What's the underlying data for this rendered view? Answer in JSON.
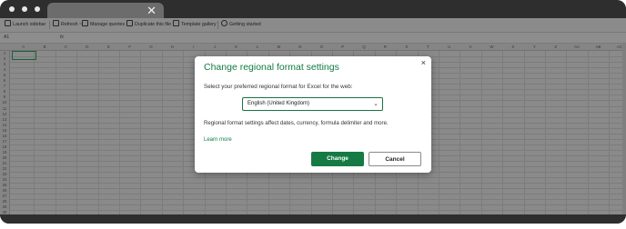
{
  "browser": {
    "tab_close": "✕"
  },
  "toolbar": {
    "items": [
      {
        "label": "Launch sidebar",
        "icon": "sidebar-icon"
      },
      {
        "label": "Refresh ~",
        "icon": "refresh-icon"
      },
      {
        "label": "Manage queries",
        "icon": "queries-icon"
      },
      {
        "label": "Duplicate this file",
        "icon": "duplicate-icon"
      },
      {
        "label": "Template gallery",
        "icon": "template-icon"
      },
      {
        "label": "Getting started",
        "icon": "help-icon"
      }
    ]
  },
  "formula_bar": {
    "cell_ref": "A1",
    "fx": "fx"
  },
  "sheet": {
    "columns": [
      "A",
      "B",
      "C",
      "D",
      "E",
      "F",
      "G",
      "H",
      "I",
      "J",
      "K",
      "L",
      "M",
      "N",
      "O",
      "P",
      "Q",
      "R",
      "S",
      "T",
      "U",
      "V",
      "W",
      "X",
      "Y",
      "Z",
      "AA",
      "AB",
      "AC"
    ],
    "rows": [
      "1",
      "2",
      "3",
      "4",
      "5",
      "6",
      "7",
      "8",
      "9",
      "10",
      "11",
      "12",
      "13",
      "14",
      "15",
      "16",
      "17",
      "18",
      "19",
      "20",
      "21",
      "22",
      "23",
      "24",
      "25",
      "26",
      "27",
      "28",
      "29",
      "30"
    ]
  },
  "dialog": {
    "title": "Change regional format settings",
    "close": "×",
    "prompt": "Select your preferred regional format for Excel for the web:",
    "selected_value": "English (United Kingdom)",
    "chevron": "⌄",
    "info": "Regional format settings affect dates, currency, formula delimiter and more.",
    "learn_more": "Learn more",
    "primary_button": "Change",
    "secondary_button": "Cancel"
  },
  "colors": {
    "accent": "#127a43",
    "primary_button": "#157a44"
  }
}
